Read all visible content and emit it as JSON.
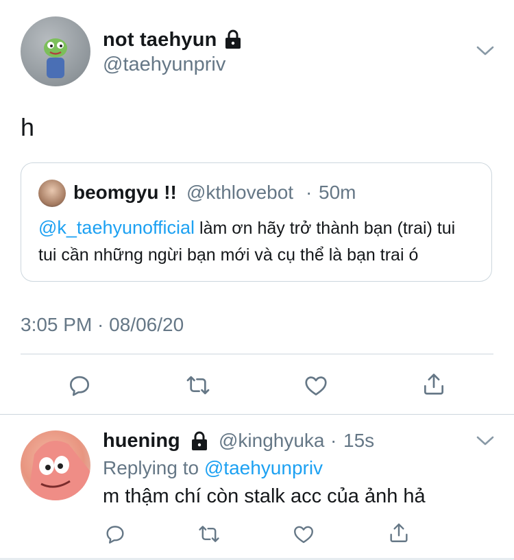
{
  "tweet": {
    "author_name": "not taehyun",
    "author_handle": "@taehyunpriv",
    "text": "h",
    "timestamp": "3:05 PM · 08/06/20",
    "quoted": {
      "author_name": "beomgyu !!",
      "author_handle": "@kthlovebot",
      "separator": "·",
      "time": "50m",
      "mention": "@k_taehyunofficial",
      "line1_rest": " làm ơn hãy trở thành bạn (trai) tui",
      "line2": "tui cần những ngừi bạn mới và cụ thể là bạn trai ó"
    }
  },
  "reply": {
    "author_name": "huening",
    "author_handle": "@kinghyuka",
    "separator": "·",
    "time": "15s",
    "replying_prefix": "Replying to ",
    "replying_mention": "@taehyunpriv",
    "text": "m thậm chí còn stalk acc của ảnh hả"
  },
  "icons": {
    "reply": "reply-icon",
    "retweet": "retweet-icon",
    "like": "like-icon",
    "share": "share-icon",
    "lock": "lock-icon",
    "chevron": "chevron-down-icon"
  },
  "colors": {
    "accent": "#1da1f2",
    "secondary_text": "#657786",
    "divider": "#ccd6dd"
  }
}
